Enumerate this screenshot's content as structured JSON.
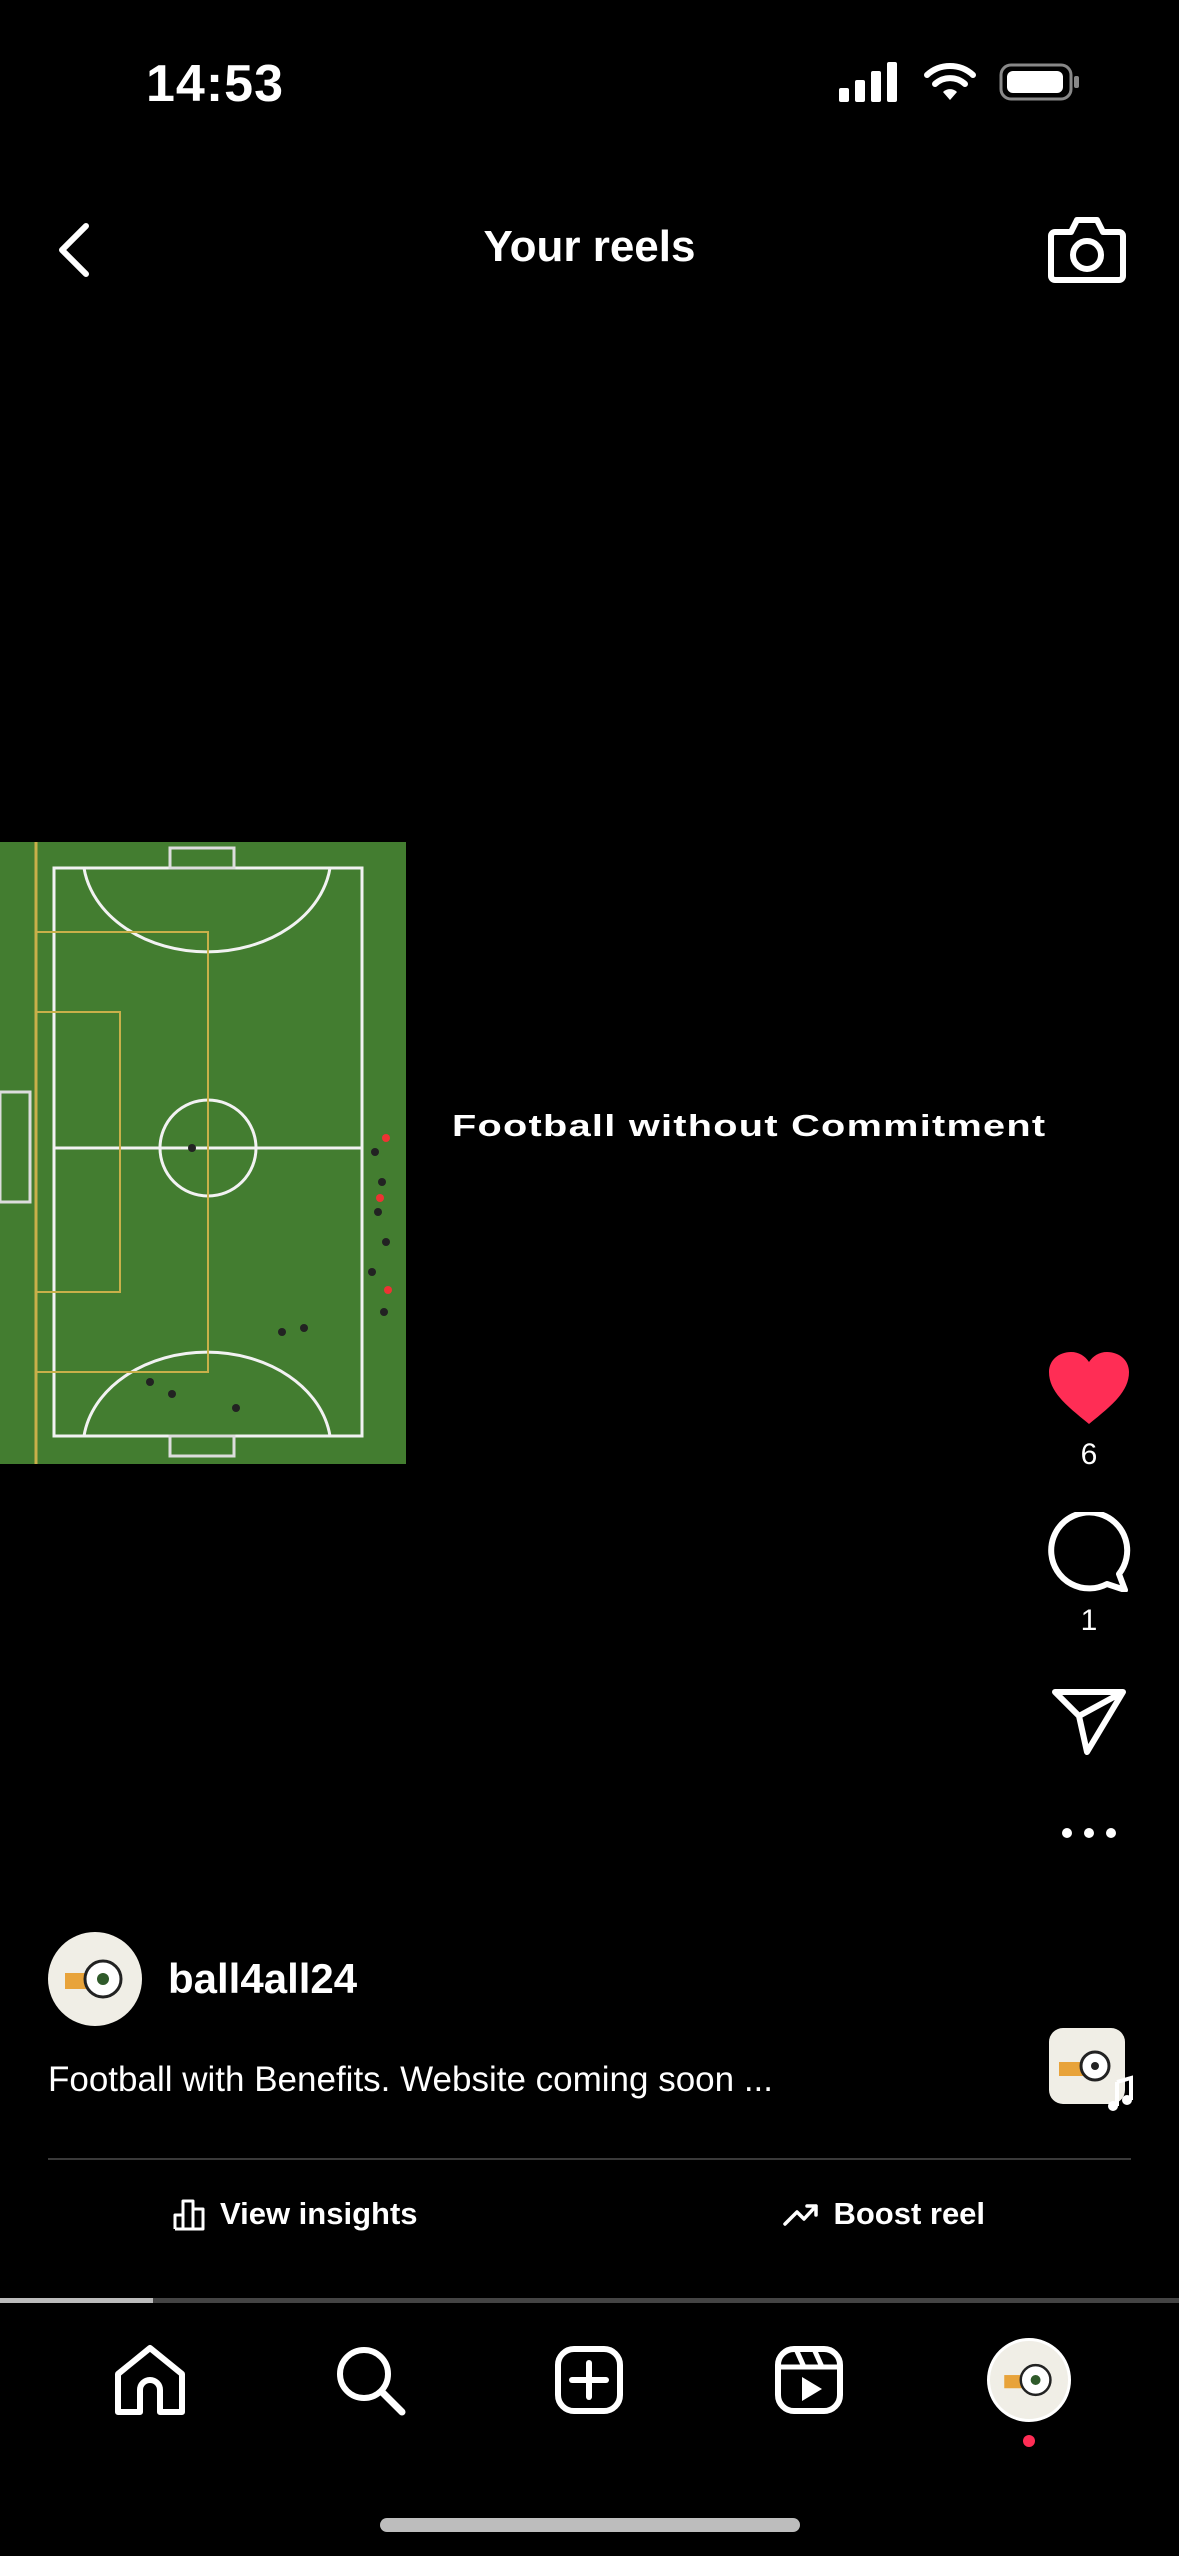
{
  "status_bar": {
    "time": "14:53"
  },
  "header": {
    "title": "Your reels"
  },
  "video": {
    "overlay_text": "Football without Commitment"
  },
  "actions": {
    "likes": "6",
    "comments": "1"
  },
  "post": {
    "username": "ball4all24",
    "caption": "Football with Benefits. Website coming soon ..."
  },
  "insights": {
    "view_label": "View insights",
    "boost_label": "Boost reel"
  },
  "playback": {
    "progress": 0.13
  },
  "colors": {
    "like": "#ff2d55",
    "background": "#000000",
    "pitch": "#3f7a2e"
  },
  "nav": {
    "items": [
      "home-icon",
      "search-icon",
      "create-icon",
      "reels-icon",
      "profile-avatar"
    ]
  }
}
